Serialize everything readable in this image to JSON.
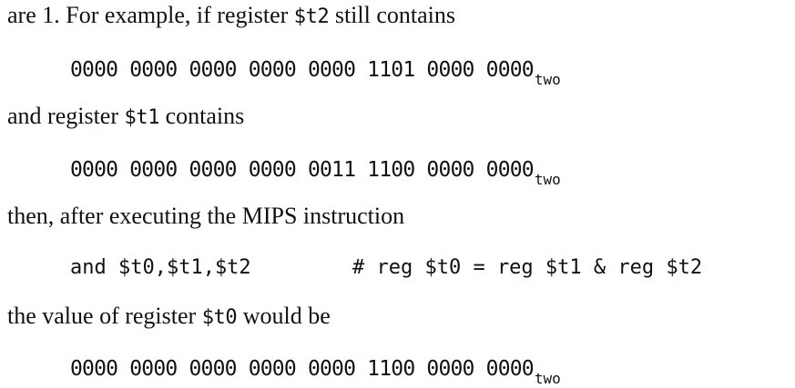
{
  "paragraphs": {
    "p1": {
      "before": "are 1. For example, if register ",
      "reg": "$t2",
      "after": " still contains"
    },
    "p2": {
      "before": "and register ",
      "reg": "$t1",
      "after": " contains"
    },
    "p3": {
      "text": "then, after executing the MIPS instruction"
    },
    "p4": {
      "before": "the value of register ",
      "reg": "$t0",
      "after": " would be"
    }
  },
  "values": {
    "t2": {
      "bits": "0000 0000 0000 0000 0000 1101 0000 0000",
      "base": "two"
    },
    "t1": {
      "bits": "0000 0000 0000 0000 0011 1100 0000 0000",
      "base": "two"
    },
    "t0": {
      "bits": "0000 0000 0000 0000 0000 1100 0000 0000",
      "base": "two"
    }
  },
  "instruction": {
    "code": "and $t0,$t1,$t2",
    "comment": "# reg $t0 = reg $t1 & reg $t2"
  }
}
